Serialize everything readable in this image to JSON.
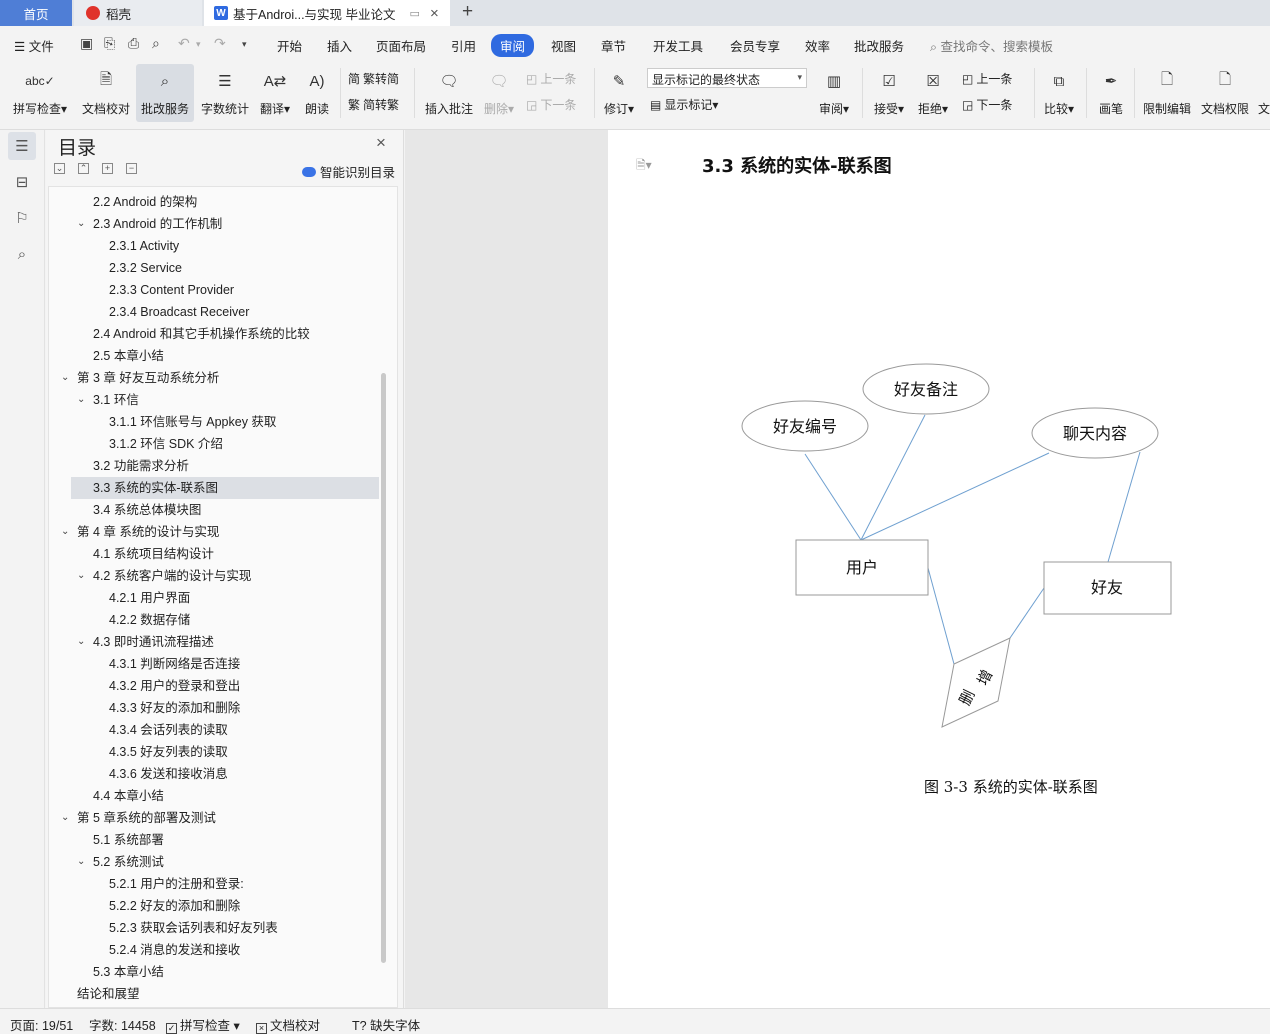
{
  "tabs": [
    {
      "label": "首页"
    },
    {
      "label": "稻壳"
    },
    {
      "label": "基于Androi...与实现 毕业论文"
    }
  ],
  "menu": {
    "file": "文件",
    "items": [
      "开始",
      "插入",
      "页面布局",
      "引用",
      "审阅",
      "视图",
      "章节",
      "开发工具",
      "会员专享",
      "效率",
      "批改服务"
    ],
    "active": "审阅",
    "search": "查找命令、搜索模板"
  },
  "ribbon": {
    "spellcheck": "拼写检查",
    "doc_proof": "文档校对",
    "correction_service": "批改服务",
    "word_count": "字数统计",
    "translate": "翻译",
    "read_aloud": "朗读",
    "to_traditional": "简转繁",
    "to_simplified": "繁转简",
    "insert_comment": "插入批注",
    "delete": "删除",
    "prev": "上一条",
    "next": "下一条",
    "revise": "修订",
    "markup_state": "显示标记的最终状态",
    "show_markup": "显示标记",
    "review": "审阅",
    "accept": "接受",
    "reject": "拒绝",
    "prev2": "上一条",
    "next2": "下一条",
    "compare": "比较",
    "pen": "画笔",
    "restrict_edit": "限制编辑",
    "doc_permission": "文档权限",
    "cut_label": "文"
  },
  "toc": {
    "title": "目录",
    "smart": "智能识别目录",
    "items": [
      {
        "label": "2.2 Android 的架构",
        "level": 2,
        "arrow": ""
      },
      {
        "label": "2.3 Android 的工作机制",
        "level": 2,
        "arrow": "v"
      },
      {
        "label": "2.3.1 Activity",
        "level": 3,
        "arrow": ""
      },
      {
        "label": "2.3.2 Service",
        "level": 3,
        "arrow": ""
      },
      {
        "label": "2.3.3 Content Provider",
        "level": 3,
        "arrow": ""
      },
      {
        "label": "2.3.4 Broadcast Receiver",
        "level": 3,
        "arrow": ""
      },
      {
        "label": "2.4 Android 和其它手机操作系统的比较",
        "level": 2,
        "arrow": ""
      },
      {
        "label": "2.5 本章小结",
        "level": 2,
        "arrow": ""
      },
      {
        "label": "第 3 章  好友互动系统分析",
        "level": 1,
        "arrow": "v"
      },
      {
        "label": "3.1 环信",
        "level": 2,
        "arrow": "v"
      },
      {
        "label": "3.1.1 环信账号与 Appkey 获取",
        "level": 3,
        "arrow": ""
      },
      {
        "label": "3.1.2  环信  SDK 介绍",
        "level": 3,
        "arrow": ""
      },
      {
        "label": "3.2 功能需求分析",
        "level": 2,
        "arrow": ""
      },
      {
        "label": "3.3 系统的实体-联系图",
        "level": 2,
        "arrow": "",
        "selected": true
      },
      {
        "label": "3.4 系统总体模块图",
        "level": 2,
        "arrow": ""
      },
      {
        "label": "第 4 章  系统的设计与实现",
        "level": 1,
        "arrow": "v"
      },
      {
        "label": "4.1  系统项目结构设计",
        "level": 2,
        "arrow": ""
      },
      {
        "label": "4.2  系统客户端的设计与实现",
        "level": 2,
        "arrow": "v"
      },
      {
        "label": "4.2.1 用户界面",
        "level": 3,
        "arrow": ""
      },
      {
        "label": "4.2.2  数据存储",
        "level": 3,
        "arrow": ""
      },
      {
        "label": "4.3 即时通讯流程描述",
        "level": 2,
        "arrow": "v"
      },
      {
        "label": "4.3.1 判断网络是否连接",
        "level": 3,
        "arrow": ""
      },
      {
        "label": "4.3.2 用户的登录和登出",
        "level": 3,
        "arrow": ""
      },
      {
        "label": "4.3.3 好友的添加和删除",
        "level": 3,
        "arrow": ""
      },
      {
        "label": "4.3.4 会话列表的读取",
        "level": 3,
        "arrow": ""
      },
      {
        "label": "4.3.5 好友列表的读取",
        "level": 3,
        "arrow": ""
      },
      {
        "label": "4.3.6 发送和接收消息",
        "level": 3,
        "arrow": ""
      },
      {
        "label": "4.4 本章小结",
        "level": 2,
        "arrow": ""
      },
      {
        "label": "第 5 章系统的部署及测试",
        "level": 1,
        "arrow": "v"
      },
      {
        "label": "5.1 系统部署",
        "level": 2,
        "arrow": ""
      },
      {
        "label": "5.2 系统测试",
        "level": 2,
        "arrow": "v"
      },
      {
        "label": "5.2.1 用户的注册和登录:",
        "level": 3,
        "arrow": ""
      },
      {
        "label": "5.2.2 好友的添加和删除",
        "level": 3,
        "arrow": ""
      },
      {
        "label": "5.2.3 获取会话列表和好友列表",
        "level": 3,
        "arrow": ""
      },
      {
        "label": "5.2.4 消息的发送和接收",
        "level": 3,
        "arrow": ""
      },
      {
        "label": "5.3 本章小结",
        "level": 2,
        "arrow": ""
      },
      {
        "label": "结论和展望",
        "level": 1,
        "arrow": ""
      }
    ]
  },
  "document": {
    "heading": "3.3 系统的实体-联系图",
    "caption": "图 3-3 系统的实体-联系图",
    "er": {
      "attr_friend_id": "好友编号",
      "attr_friend_note": "好友备注",
      "attr_chat_content": "聊天内容",
      "entity_user": "用户",
      "entity_friend": "好友",
      "rel_line1": "增",
      "rel_line2": "删"
    }
  },
  "status": {
    "page": "页面: 19/51",
    "words": "字数: 14458",
    "spell": "拼写检查",
    "proof": "文档校对",
    "missing_font": "缺失字体"
  },
  "colors": {
    "accent": "#2f6ae0",
    "home_tab": "#4f7ed6",
    "er_line": "#6fa0d0"
  }
}
